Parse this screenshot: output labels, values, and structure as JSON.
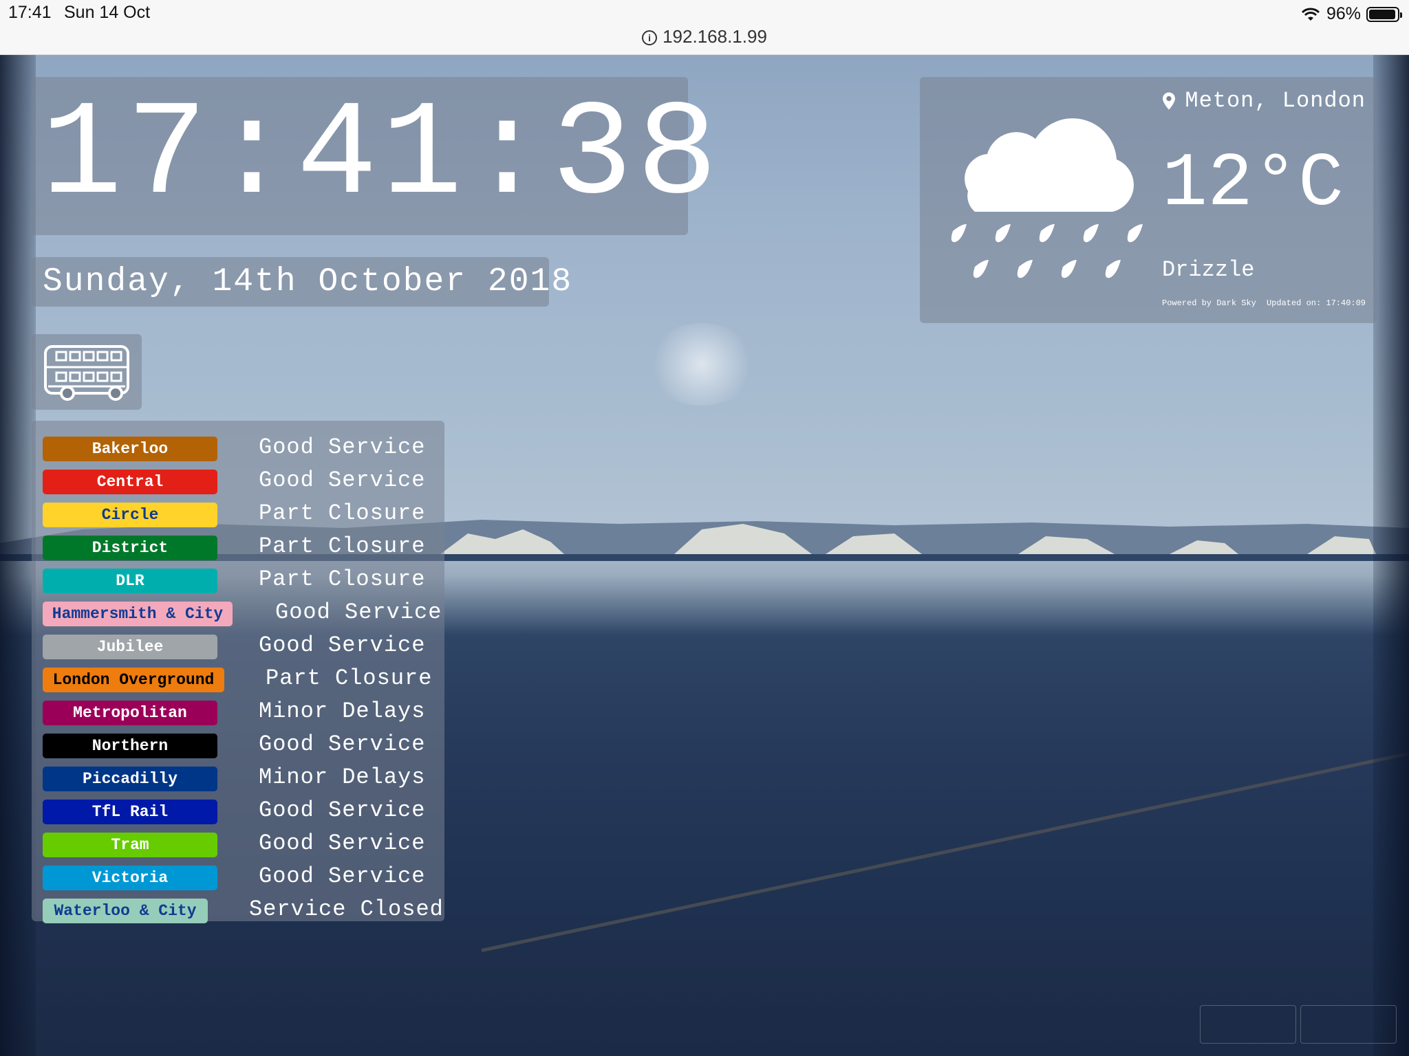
{
  "status_bar": {
    "time": "17:41",
    "date": "Sun 14 Oct",
    "battery": "96%",
    "battery_level": 0.96
  },
  "browser": {
    "url": "192.168.1.99"
  },
  "clock": {
    "time": "17:41:38"
  },
  "date": {
    "text": "Sunday, 14th October 2018"
  },
  "weather": {
    "location": "Meton, London",
    "temperature": "12°C",
    "summary": "Drizzle",
    "powered_by": "Powered by Dark Sky",
    "updated": "Updated on: 17:40:09",
    "icon": "rain-cloud-icon"
  },
  "transport": {
    "icon": "bus-icon",
    "lines": [
      {
        "name": "Bakerloo",
        "status": "Good Service",
        "bg": "#b36305",
        "fg": "#ffffff"
      },
      {
        "name": "Central",
        "status": "Good Service",
        "bg": "#e32017",
        "fg": "#ffffff"
      },
      {
        "name": "Circle",
        "status": "Part Closure",
        "bg": "#ffd329",
        "fg": "#113b92"
      },
      {
        "name": "District",
        "status": "Part Closure",
        "bg": "#00782a",
        "fg": "#ffffff"
      },
      {
        "name": "DLR",
        "status": "Part Closure",
        "bg": "#00afad",
        "fg": "#ffffff"
      },
      {
        "name": "Hammersmith & City",
        "status": "Good Service",
        "bg": "#f3a9bb",
        "fg": "#113b92"
      },
      {
        "name": "Jubilee",
        "status": "Good Service",
        "bg": "#a0a5a9",
        "fg": "#ffffff"
      },
      {
        "name": "London Overground",
        "status": "Part Closure",
        "bg": "#ee7c0e",
        "fg": "#000000"
      },
      {
        "name": "Metropolitan",
        "status": "Minor Delays",
        "bg": "#9b0058",
        "fg": "#ffffff"
      },
      {
        "name": "Northern",
        "status": "Good Service",
        "bg": "#000000",
        "fg": "#ffffff"
      },
      {
        "name": "Piccadilly",
        "status": "Minor Delays",
        "bg": "#003688",
        "fg": "#ffffff"
      },
      {
        "name": "TfL Rail",
        "status": "Good Service",
        "bg": "#0019a8",
        "fg": "#ffffff"
      },
      {
        "name": "Tram",
        "status": "Good Service",
        "bg": "#66cc00",
        "fg": "#ffffff"
      },
      {
        "name": "Victoria",
        "status": "Good Service",
        "bg": "#0098d4",
        "fg": "#ffffff"
      },
      {
        "name": "Waterloo & City",
        "status": "Service Closed",
        "bg": "#95cdba",
        "fg": "#113b92"
      }
    ]
  }
}
